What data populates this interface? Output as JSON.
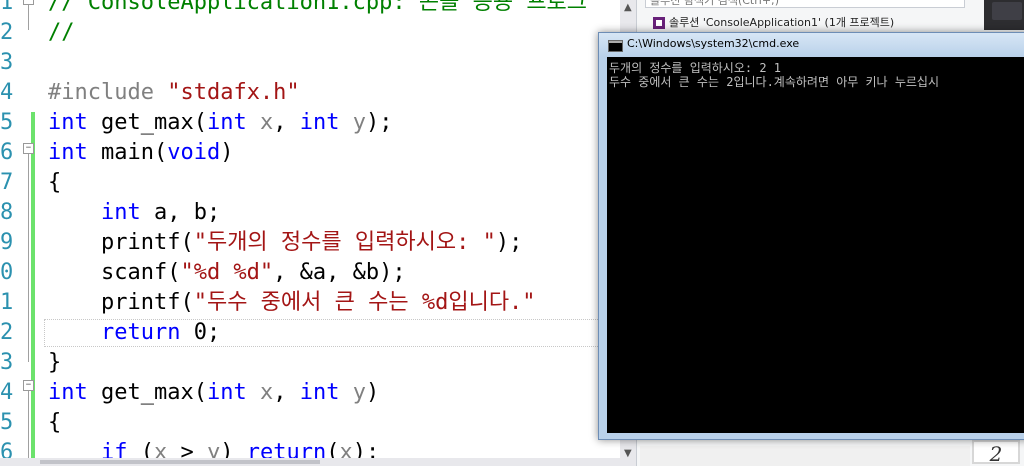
{
  "editor": {
    "gutter_numbers": [
      "1",
      "2",
      "3",
      "4",
      "5",
      "6",
      "7",
      "8",
      "9",
      "0",
      "1",
      "2",
      "3",
      "4",
      "5",
      "6"
    ],
    "lines": [
      [
        {
          "t": "// ConsoleApplication1.cpp: 콘솔 응용 프로그",
          "c": "comment"
        }
      ],
      [
        {
          "t": "//",
          "c": "comment"
        }
      ],
      [],
      [
        {
          "t": "#include ",
          "c": "directive"
        },
        {
          "t": "\"stdafx.h\"",
          "c": "string"
        }
      ],
      [
        {
          "t": "int",
          "c": "keyword"
        },
        {
          "t": " get_max(",
          "c": "ident"
        },
        {
          "t": "int",
          "c": "keyword"
        },
        {
          "t": " ",
          "c": "ident"
        },
        {
          "t": "x",
          "c": "param"
        },
        {
          "t": ", ",
          "c": "ident"
        },
        {
          "t": "int",
          "c": "keyword"
        },
        {
          "t": " ",
          "c": "ident"
        },
        {
          "t": "y",
          "c": "param"
        },
        {
          "t": ");",
          "c": "ident"
        }
      ],
      [
        {
          "t": "int",
          "c": "keyword"
        },
        {
          "t": " main(",
          "c": "ident"
        },
        {
          "t": "void",
          "c": "keyword"
        },
        {
          "t": ")",
          "c": "ident"
        }
      ],
      [
        {
          "t": "{",
          "c": "ident"
        }
      ],
      [
        {
          "t": "    ",
          "c": "ident"
        },
        {
          "t": "int",
          "c": "keyword"
        },
        {
          "t": " a, b;",
          "c": "ident"
        }
      ],
      [
        {
          "t": "    printf(",
          "c": "ident"
        },
        {
          "t": "\"두개의 정수를 입력하시오: \"",
          "c": "string"
        },
        {
          "t": ");",
          "c": "ident"
        }
      ],
      [
        {
          "t": "    scanf(",
          "c": "ident"
        },
        {
          "t": "\"%d %d\"",
          "c": "string"
        },
        {
          "t": ", &a, &b);",
          "c": "ident"
        }
      ],
      [
        {
          "t": "    printf(",
          "c": "ident"
        },
        {
          "t": "\"두수 중에서 큰 수는 %d입니다.\"",
          "c": "string"
        }
      ],
      [
        {
          "t": "    ",
          "c": "ident"
        },
        {
          "t": "return",
          "c": "keyword"
        },
        {
          "t": " 0;",
          "c": "ident"
        }
      ],
      [
        {
          "t": "}",
          "c": "ident"
        }
      ],
      [
        {
          "t": "int",
          "c": "keyword"
        },
        {
          "t": " get_max(",
          "c": "ident"
        },
        {
          "t": "int",
          "c": "keyword"
        },
        {
          "t": " ",
          "c": "ident"
        },
        {
          "t": "x",
          "c": "param"
        },
        {
          "t": ", ",
          "c": "ident"
        },
        {
          "t": "int",
          "c": "keyword"
        },
        {
          "t": " ",
          "c": "ident"
        },
        {
          "t": "y",
          "c": "param"
        },
        {
          "t": ")",
          "c": "ident"
        }
      ],
      [
        {
          "t": "{",
          "c": "ident"
        }
      ],
      [
        {
          "t": "    ",
          "c": "ident"
        },
        {
          "t": "if",
          "c": "keyword"
        },
        {
          "t": " (",
          "c": "ident"
        },
        {
          "t": "x",
          "c": "param"
        },
        {
          "t": " > ",
          "c": "ident"
        },
        {
          "t": "y",
          "c": "param"
        },
        {
          "t": ") ",
          "c": "ident"
        },
        {
          "t": "return",
          "c": "keyword"
        },
        {
          "t": "(",
          "c": "ident"
        },
        {
          "t": "x",
          "c": "param"
        },
        {
          "t": ");",
          "c": "ident"
        }
      ]
    ]
  },
  "solution_explorer": {
    "search_placeholder": "솔루션 탐색기 검색(Ctrl+;)",
    "root_label": "솔루션 'ConsoleApplication1' (1개 프로젝트)"
  },
  "page_counter": "2",
  "console": {
    "title": "C:\\Windows\\system32\\cmd.exe",
    "lines": [
      "두개의 정수를 입력하시오: 2 1",
      "두수 중에서 큰 수는 2입니다.계속하려면 아무 키나 누르십시"
    ]
  },
  "colors": {
    "keyword": "#0000ff",
    "string": "#a31515",
    "comment": "#008000",
    "console_bg": "#000000",
    "console_text": "#c0c0c0"
  }
}
